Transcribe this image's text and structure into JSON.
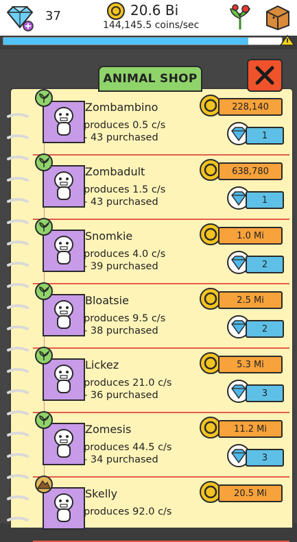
{
  "topbar": {
    "gems": "37",
    "coins_total": "20.6 Bi",
    "coins_rate": "144,145.5 coins/sec",
    "progress_fraction": 0.88
  },
  "shop": {
    "title": "ANIMAL SHOP",
    "close_label": "X"
  },
  "animals": [
    {
      "name": "Zombambino",
      "produces": "produces 0.5 c/s",
      "purchased": "- 43 purchased",
      "coin_price": "228,140",
      "gem_price": "1",
      "badge": "sprout-icon"
    },
    {
      "name": "Zombadult",
      "produces": "produces 1.5 c/s",
      "purchased": "- 43 purchased",
      "coin_price": "638,780",
      "gem_price": "1",
      "badge": "sprout-icon"
    },
    {
      "name": "Snomkie",
      "produces": "produces 4.0 c/s",
      "purchased": "- 39 purchased",
      "coin_price": "1.0 Mi",
      "gem_price": "2",
      "badge": "sprout-icon"
    },
    {
      "name": "Bloatsie",
      "produces": "produces 9.5 c/s",
      "purchased": "- 38 purchased",
      "coin_price": "2.5 Mi",
      "gem_price": "2",
      "badge": "sprout-icon"
    },
    {
      "name": "Lickez",
      "produces": "produces 21.0 c/s",
      "purchased": "- 36 purchased",
      "coin_price": "5.3 Mi",
      "gem_price": "3",
      "badge": "sprout-icon"
    },
    {
      "name": "Zomesis",
      "produces": "produces 44.5 c/s",
      "purchased": "- 34 purchased",
      "coin_price": "11.2 Mi",
      "gem_price": "3",
      "badge": "sprout-icon"
    },
    {
      "name": "Skelly",
      "produces": "produces 92.0 c/s",
      "purchased": "",
      "coin_price": "20.5 Mi",
      "gem_price": "",
      "badge": "mountain-icon"
    }
  ],
  "colors": {
    "accent_green": "#8fd46a",
    "close_red": "#f0532c",
    "coin_plate": "#f7a23a",
    "gem_plate": "#5ec0e6",
    "paper": "#fff4b8",
    "portrait": "#c79be8",
    "divider": "#e35c4a"
  }
}
